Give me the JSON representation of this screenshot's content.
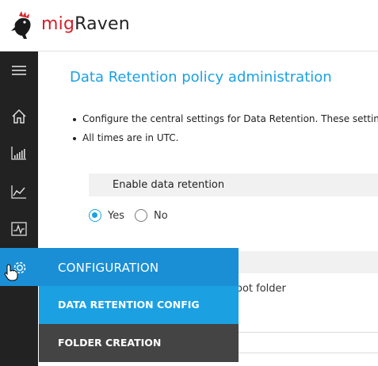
{
  "app": {
    "name_part1": "mig",
    "name_part2": "Raven"
  },
  "sidebar": {
    "items": [
      {
        "icon": "hamburger-icon"
      },
      {
        "icon": "home-icon"
      },
      {
        "icon": "bar-chart-icon"
      },
      {
        "icon": "line-chart-icon"
      },
      {
        "icon": "activity-icon"
      },
      {
        "icon": "gear-icon"
      }
    ]
  },
  "page": {
    "title": "Data Retention policy administration",
    "notes": [
      "Configure the central settings for Data Retention. These setting",
      "All times are in UTC."
    ],
    "enable_label": "Enable data retention",
    "radio_yes": "Yes",
    "radio_no": "No",
    "selected": "Yes",
    "partial_text": "oot folder"
  },
  "flyout": {
    "header": "CONFIGURATION",
    "items": [
      "DATA RETENTION CONFIG",
      "FOLDER CREATION"
    ],
    "active_index": 0
  },
  "colors": {
    "accent": "#1ba1e2",
    "brand_red": "#d6202a",
    "sidebar": "#222222"
  }
}
